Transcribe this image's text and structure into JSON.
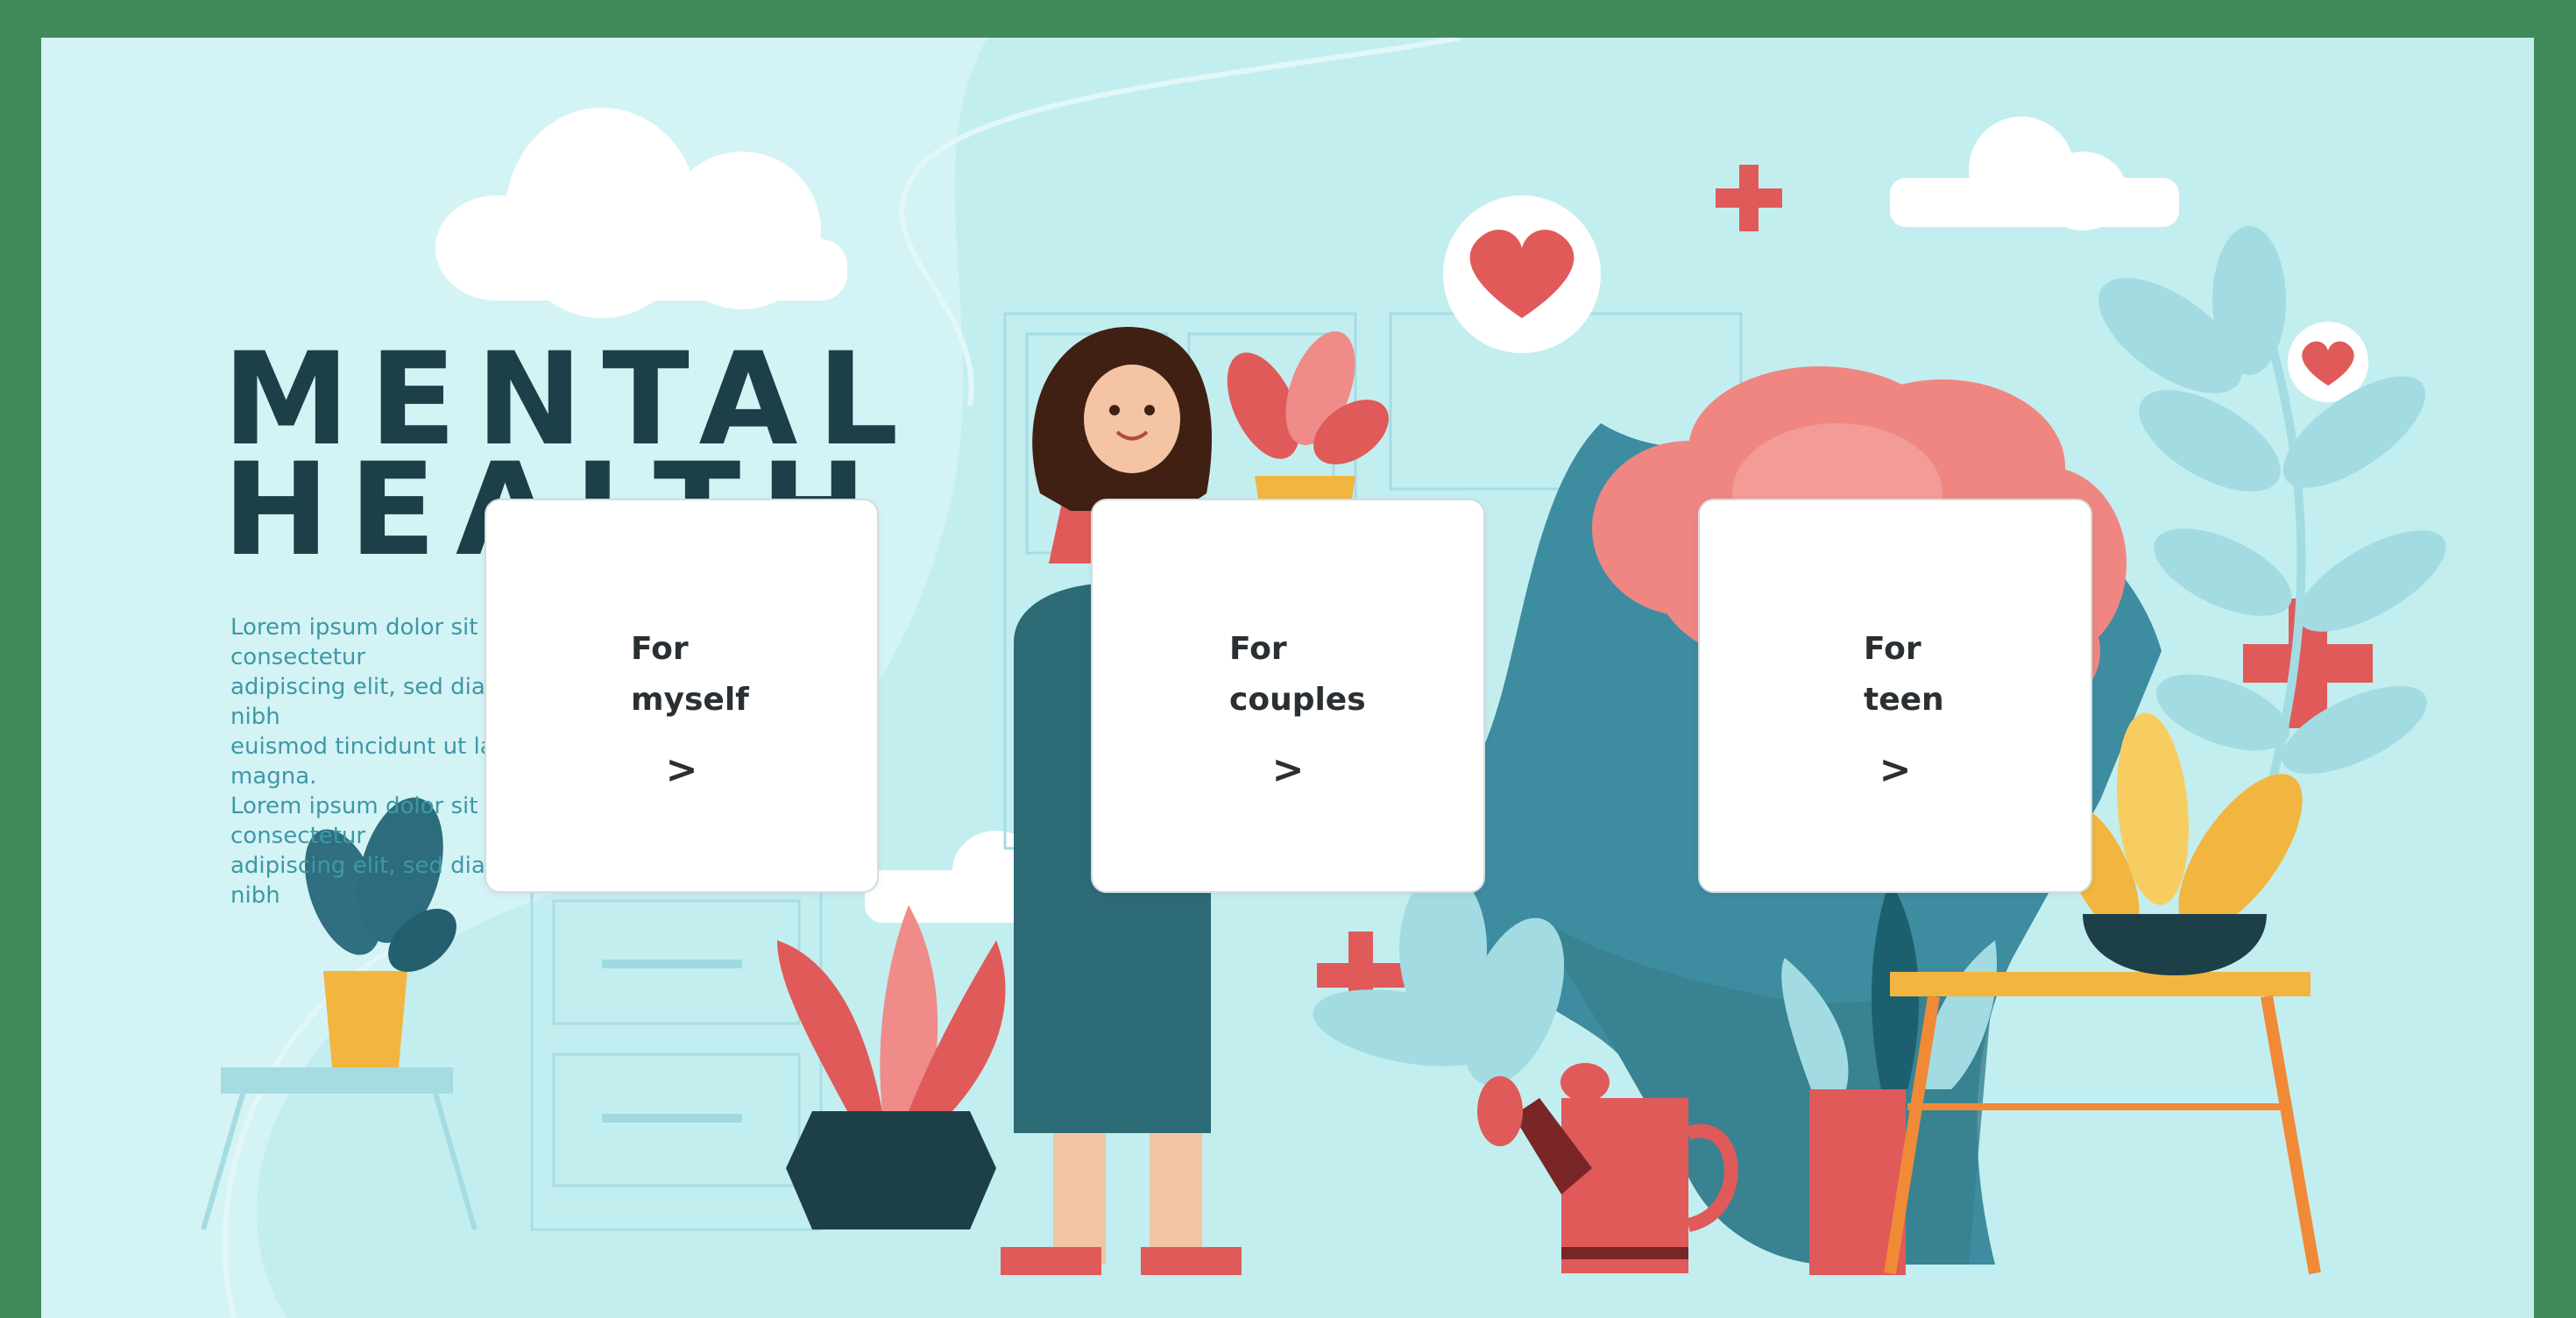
{
  "hero": {
    "title_line_1": "MENTAL",
    "title_line_2": "HEALTH",
    "body_text": "Lorem ipsum dolor sit amet, consectetur\nadipiscing elit, sed diam nonummy nibh\neuismod tincidunt ut laoreet dolore magna.\nLorem ipsum dolor sit amet, consectetur\nadipiscing elit, sed diam nonummy nibh"
  },
  "cards": [
    {
      "line1": "For",
      "line2": "myself",
      "arrow": ">"
    },
    {
      "line1": "For",
      "line2": "couples",
      "arrow": ">"
    },
    {
      "line1": "For",
      "line2": "teen",
      "arrow": ">"
    }
  ],
  "colors": {
    "border": "#418a5a",
    "background": "#d4f3f5",
    "title": "#1c3f48",
    "body_text": "#3d98a8",
    "accent_red": "#e05a59",
    "teal": "#3e8ca0",
    "yellow": "#f3b443"
  }
}
